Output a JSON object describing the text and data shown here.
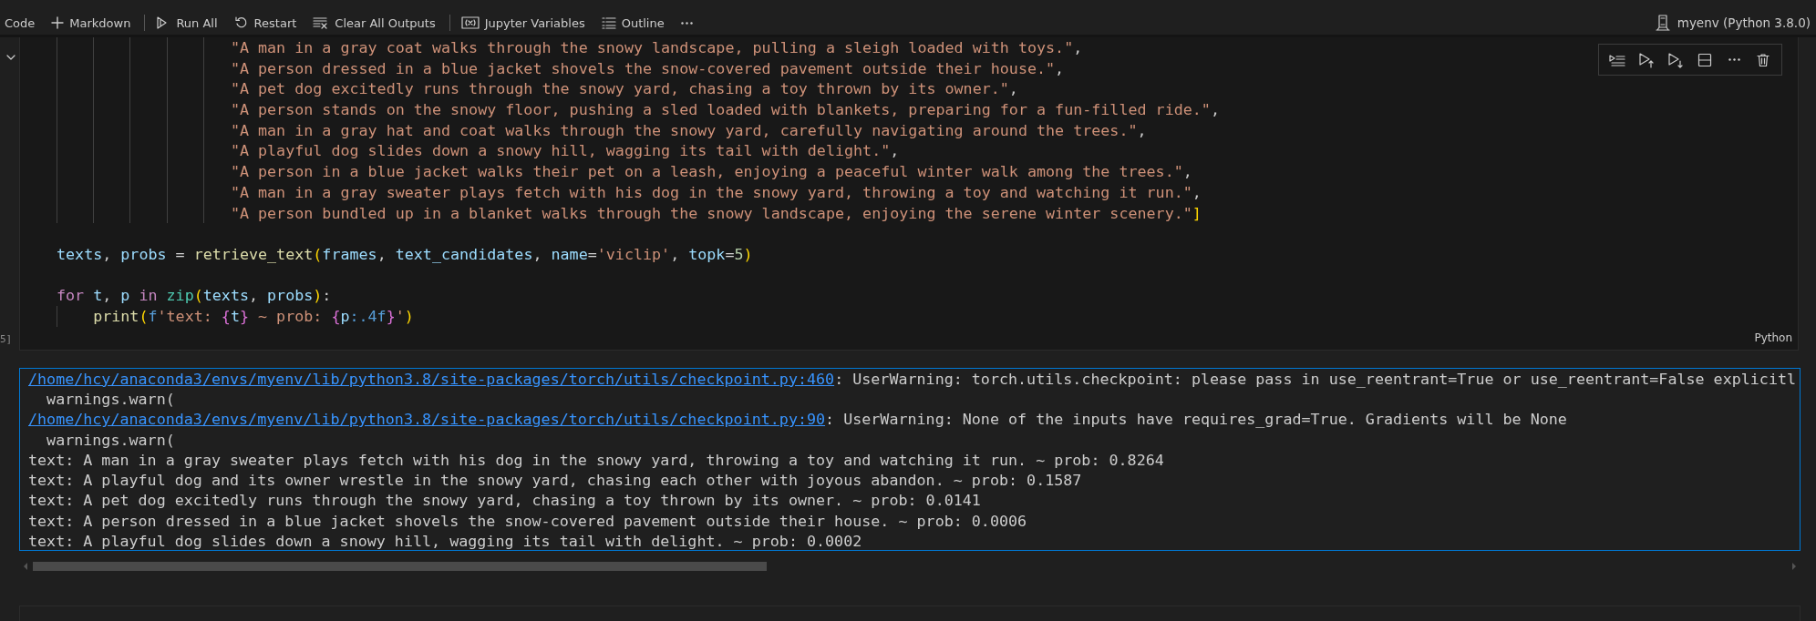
{
  "toolbar": {
    "items": [
      {
        "kind": "text",
        "label": "Code"
      },
      {
        "kind": "add",
        "label": "Markdown"
      },
      {
        "kind": "separator"
      },
      {
        "kind": "run-all",
        "label": "Run All"
      },
      {
        "kind": "restart",
        "label": "Restart"
      },
      {
        "kind": "clear",
        "label": "Clear All Outputs"
      },
      {
        "kind": "separator"
      },
      {
        "kind": "variables",
        "label": "Jupyter Variables"
      },
      {
        "kind": "outline",
        "label": "Outline"
      },
      {
        "kind": "more"
      }
    ],
    "kernel": {
      "label": "myenv (Python 3.8.0)"
    }
  },
  "code_cell": {
    "execution_count": "5]",
    "language": "Python",
    "actions": [
      {
        "kind": "run-by-line"
      },
      {
        "kind": "run-above"
      },
      {
        "kind": "run-below"
      },
      {
        "kind": "split"
      },
      {
        "kind": "more"
      },
      {
        "kind": "delete"
      }
    ],
    "lines": [
      {
        "kind": "list-item",
        "tokens": [
          {
            "kind": "str",
            "text": "\"A man in a gray coat walks through the snowy landscape, pulling a sleigh loaded with toys.\""
          },
          {
            "kind": "punct",
            "text": ","
          }
        ]
      },
      {
        "kind": "list-item",
        "tokens": [
          {
            "kind": "str",
            "text": "\"A person dressed in a blue jacket shovels the snow-covered pavement outside their house.\""
          },
          {
            "kind": "punct",
            "text": ","
          }
        ]
      },
      {
        "kind": "list-item",
        "tokens": [
          {
            "kind": "str",
            "text": "\"A pet dog excitedly runs through the snowy yard, chasing a toy thrown by its owner.\""
          },
          {
            "kind": "punct",
            "text": ","
          }
        ]
      },
      {
        "kind": "list-item",
        "tokens": [
          {
            "kind": "str",
            "text": "\"A person stands on the snowy floor, pushing a sled loaded with blankets, preparing for a fun-filled ride.\""
          },
          {
            "kind": "punct",
            "text": ","
          }
        ]
      },
      {
        "kind": "list-item",
        "tokens": [
          {
            "kind": "str",
            "text": "\"A man in a gray hat and coat walks through the snowy yard, carefully navigating around the trees.\""
          },
          {
            "kind": "punct",
            "text": ","
          }
        ]
      },
      {
        "kind": "list-item",
        "tokens": [
          {
            "kind": "str",
            "text": "\"A playful dog slides down a snowy hill, wagging its tail with delight.\""
          },
          {
            "kind": "punct",
            "text": ","
          }
        ]
      },
      {
        "kind": "list-item",
        "tokens": [
          {
            "kind": "str",
            "text": "\"A person in a blue jacket walks their pet on a leash, enjoying a peaceful winter walk among the trees.\""
          },
          {
            "kind": "punct",
            "text": ","
          }
        ]
      },
      {
        "kind": "list-item",
        "tokens": [
          {
            "kind": "str",
            "text": "\"A man in a gray sweater plays fetch with his dog in the snowy yard, throwing a toy and watching it run.\""
          },
          {
            "kind": "punct",
            "text": ","
          }
        ]
      },
      {
        "kind": "list-item",
        "tokens": [
          {
            "kind": "str",
            "text": "\"A person bundled up in a blanket walks through the snowy landscape, enjoying the serene winter scenery.\""
          },
          {
            "kind": "bracket",
            "text": "]"
          }
        ]
      },
      {
        "kind": "blank"
      },
      {
        "kind": "top",
        "tokens": [
          {
            "kind": "var",
            "text": "texts"
          },
          {
            "kind": "punct",
            "text": ", "
          },
          {
            "kind": "var",
            "text": "probs"
          },
          {
            "kind": "op",
            "text": " = "
          },
          {
            "kind": "fn",
            "text": "retrieve_text"
          },
          {
            "kind": "bracket",
            "text": "("
          },
          {
            "kind": "var",
            "text": "frames"
          },
          {
            "kind": "punct",
            "text": ", "
          },
          {
            "kind": "var",
            "text": "text_candidates"
          },
          {
            "kind": "punct",
            "text": ", "
          },
          {
            "kind": "var",
            "text": "name"
          },
          {
            "kind": "op",
            "text": "="
          },
          {
            "kind": "str",
            "text": "'viclip'"
          },
          {
            "kind": "punct",
            "text": ", "
          },
          {
            "kind": "var",
            "text": "topk"
          },
          {
            "kind": "op",
            "text": "="
          },
          {
            "kind": "num",
            "text": "5"
          },
          {
            "kind": "bracket",
            "text": ")"
          }
        ]
      },
      {
        "kind": "blank"
      },
      {
        "kind": "top",
        "tokens": [
          {
            "kind": "kw",
            "text": "for "
          },
          {
            "kind": "var",
            "text": "t"
          },
          {
            "kind": "punct",
            "text": ", "
          },
          {
            "kind": "var",
            "text": "p"
          },
          {
            "kind": "kw",
            "text": " in "
          },
          {
            "kind": "builtin",
            "text": "zip"
          },
          {
            "kind": "bracket",
            "text": "("
          },
          {
            "kind": "var",
            "text": "texts"
          },
          {
            "kind": "punct",
            "text": ", "
          },
          {
            "kind": "var",
            "text": "probs"
          },
          {
            "kind": "bracket",
            "text": ")"
          },
          {
            "kind": "punct",
            "text": ":"
          }
        ]
      },
      {
        "kind": "nested",
        "tokens": [
          {
            "kind": "fn",
            "text": "print"
          },
          {
            "kind": "bracket",
            "text": "("
          },
          {
            "kind": "storage",
            "text": "f"
          },
          {
            "kind": "str",
            "text": "'text: "
          },
          {
            "kind": "brace",
            "text": "{"
          },
          {
            "kind": "var",
            "text": "t"
          },
          {
            "kind": "brace",
            "text": "}"
          },
          {
            "kind": "str",
            "text": " ~ prob: "
          },
          {
            "kind": "brace",
            "text": "{"
          },
          {
            "kind": "var",
            "text": "p"
          },
          {
            "kind": "storage",
            "text": ":.4f"
          },
          {
            "kind": "brace",
            "text": "}"
          },
          {
            "kind": "str",
            "text": "'"
          },
          {
            "kind": "bracket",
            "text": ")"
          }
        ]
      }
    ]
  },
  "output": {
    "lines": [
      {
        "kind": "warning",
        "link": "/home/hcy/anaconda3/envs/myenv/lib/python3.8/site-packages/torch/utils/checkpoint.py:460",
        "text": ": UserWarning: torch.utils.checkpoint: please pass in use_reentrant=True or use_reentrant=False explicitl"
      },
      {
        "kind": "plain",
        "text": "  warnings.warn("
      },
      {
        "kind": "warning",
        "link": "/home/hcy/anaconda3/envs/myenv/lib/python3.8/site-packages/torch/utils/checkpoint.py:90",
        "text": ": UserWarning: None of the inputs have requires_grad=True. Gradients will be None"
      },
      {
        "kind": "plain",
        "text": "  warnings.warn("
      },
      {
        "kind": "plain",
        "text": "text: A man in a gray sweater plays fetch with his dog in the snowy yard, throwing a toy and watching it run. ~ prob: 0.8264"
      },
      {
        "kind": "plain",
        "text": "text: A playful dog and its owner wrestle in the snowy yard, chasing each other with joyous abandon. ~ prob: 0.1587"
      },
      {
        "kind": "plain",
        "text": "text: A pet dog excitedly runs through the snowy yard, chasing a toy thrown by its owner. ~ prob: 0.0141"
      },
      {
        "kind": "plain",
        "text": "text: A person dressed in a blue jacket shovels the snow-covered pavement outside their house. ~ prob: 0.0006"
      },
      {
        "kind": "plain",
        "text": "text: A playful dog slides down a snowy hill, wagging its tail with delight. ~ prob: 0.0002"
      }
    ]
  }
}
